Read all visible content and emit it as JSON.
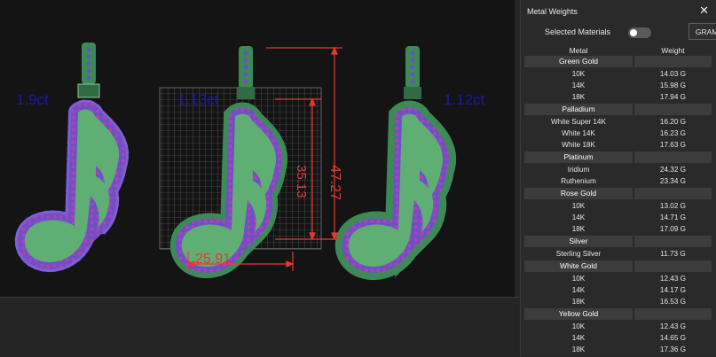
{
  "viewport": {
    "left_carat": "1.9ct",
    "center_carat": "1.13ct",
    "right_carat": "1.12ct",
    "dim_width": "25.91",
    "dim_height_outer": "47.27",
    "dim_height_inner": "35.13"
  },
  "panel": {
    "title": "Metal Weights",
    "close_icon": "close-icon",
    "selected_materials_label": "Selected Materials",
    "units_button": "GRAMS",
    "col_metal": "Metal",
    "col_weight": "Weight",
    "groups": [
      {
        "name": "Green Gold",
        "rows": [
          {
            "metal": "10K",
            "weight": "14.03 G"
          },
          {
            "metal": "14K",
            "weight": "15.98 G"
          },
          {
            "metal": "18K",
            "weight": "17.94 G"
          }
        ]
      },
      {
        "name": "Palladium",
        "rows": [
          {
            "metal": "White Super 14K",
            "weight": "16.20 G"
          },
          {
            "metal": "White 14K",
            "weight": "16.23 G"
          },
          {
            "metal": "White 18K",
            "weight": "17.63 G"
          }
        ]
      },
      {
        "name": "Platinum",
        "rows": [
          {
            "metal": "Iridium",
            "weight": "24.32 G"
          },
          {
            "metal": "Ruthenium",
            "weight": "23.34 G"
          }
        ]
      },
      {
        "name": "Rose Gold",
        "rows": [
          {
            "metal": "10K",
            "weight": "13.02 G"
          },
          {
            "metal": "14K",
            "weight": "14.71 G"
          },
          {
            "metal": "18K",
            "weight": "17.09 G"
          }
        ]
      },
      {
        "name": "Silver",
        "rows": [
          {
            "metal": "Sterling Silver",
            "weight": "11.73 G"
          }
        ]
      },
      {
        "name": "White Gold",
        "rows": [
          {
            "metal": "10K",
            "weight": "12.43 G"
          },
          {
            "metal": "14K",
            "weight": "14.17 G"
          },
          {
            "metal": "18K",
            "weight": "16.53 G"
          }
        ]
      },
      {
        "name": "Yellow Gold",
        "rows": [
          {
            "metal": "10K",
            "weight": "12.43 G"
          },
          {
            "metal": "14K",
            "weight": "14.65 G"
          },
          {
            "metal": "18K",
            "weight": "17.36 G"
          }
        ]
      }
    ]
  },
  "colors": {
    "note_fill": "#5fae74",
    "bail_fill": "#3e8a57",
    "stone_rim": "#6a52c4",
    "stone_dot": "#b040b8",
    "dimension_red": "#e53935",
    "carat_blue": "#1a1aa8"
  }
}
